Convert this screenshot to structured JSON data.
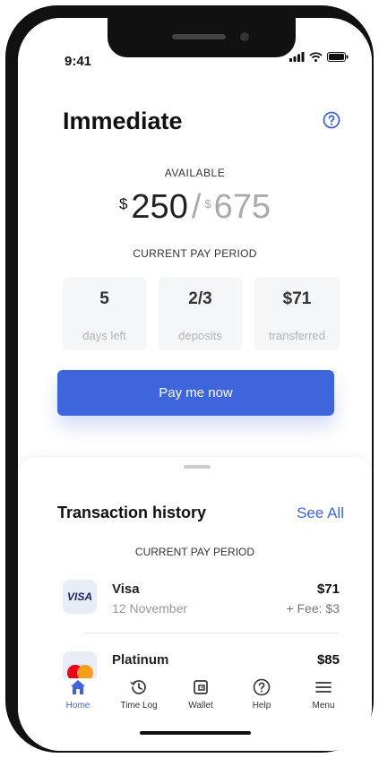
{
  "status_bar": {
    "time": "9:41"
  },
  "header": {
    "title": "Immediate"
  },
  "balance": {
    "label": "AVAILABLE",
    "currency": "$",
    "available": "250",
    "separator": "/",
    "total": "675"
  },
  "pay_period": {
    "label": "CURRENT PAY PERIOD",
    "stats": [
      {
        "value": "5",
        "label": "days left"
      },
      {
        "value": "2/3",
        "label": "deposits"
      },
      {
        "value": "$71",
        "label": "transferred"
      }
    ]
  },
  "action": {
    "pay_label": "Pay me now"
  },
  "transactions": {
    "title": "Transaction history",
    "see_all": "See All",
    "period_label": "CURRENT PAY PERIOD",
    "items": [
      {
        "name": "Visa",
        "date": "12 November",
        "amount": "$71",
        "fee": "+ Fee: $3",
        "icon_text": "VISA"
      },
      {
        "name": "Platinum",
        "amount": "$85"
      }
    ]
  },
  "nav": {
    "items": [
      {
        "label": "Home",
        "icon": "home-icon"
      },
      {
        "label": "Time Log",
        "icon": "history-icon"
      },
      {
        "label": "Wallet",
        "icon": "wallet-icon"
      },
      {
        "label": "Help",
        "icon": "help-icon"
      },
      {
        "label": "Menu",
        "icon": "menu-icon"
      }
    ]
  },
  "colors": {
    "accent": "#3f65dc",
    "muted": "#aaaaaa",
    "text": "#111111"
  }
}
